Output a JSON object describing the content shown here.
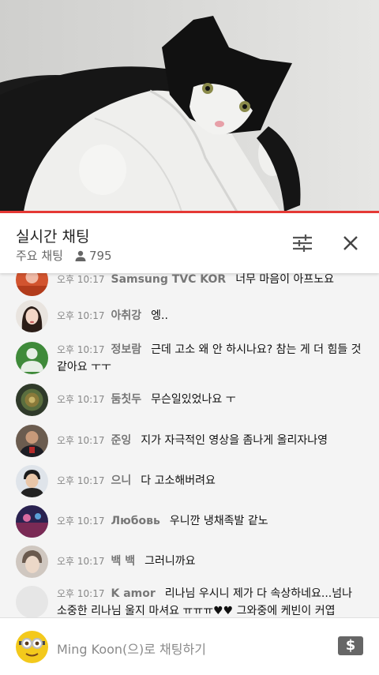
{
  "video": {
    "progress": 1.0,
    "progress_color": "#e53935"
  },
  "chat_header": {
    "title": "실시간 채팅",
    "mode": "주요 채팅",
    "viewer_count": "795"
  },
  "messages": [
    {
      "time": "오후 10:17",
      "author": "Samsung TVC KOR",
      "text": "너무 마음이 아프노요"
    },
    {
      "time": "오후 10:17",
      "author": "아취강",
      "text": "엥.."
    },
    {
      "time": "오후 10:17",
      "author": "정보람",
      "text": "근데 고소 왜 안 하시나요? 참는 게 더 힘들 것 같아요 ㅜㅜ"
    },
    {
      "time": "오후 10:17",
      "author": "둠칫두",
      "text": "무슨일있었나요 ㅜ"
    },
    {
      "time": "오후 10:17",
      "author": "준잉",
      "text": "지가 자극적인 영상을 좀나게 올리자나영"
    },
    {
      "time": "오후 10:17",
      "author": "으니",
      "text": "다 고소해버려요"
    },
    {
      "time": "오후 10:17",
      "author": "Любовь",
      "text": "우니깐 냉채족발 같노"
    },
    {
      "time": "오후 10:17",
      "author": "백 백",
      "text": "그러니까요"
    },
    {
      "time": "오후 10:17",
      "author": "K amor",
      "text": "리나님 우시니 제가 다 속상하네요...넘나 소중한 리나님 울지 마셔요 ㅠㅠㅠ♥♥ 그와중에 케빈이 커엽"
    }
  ],
  "input": {
    "placeholder": "Ming Koon(으)로 채팅하기",
    "super_chat_symbol": "$"
  }
}
